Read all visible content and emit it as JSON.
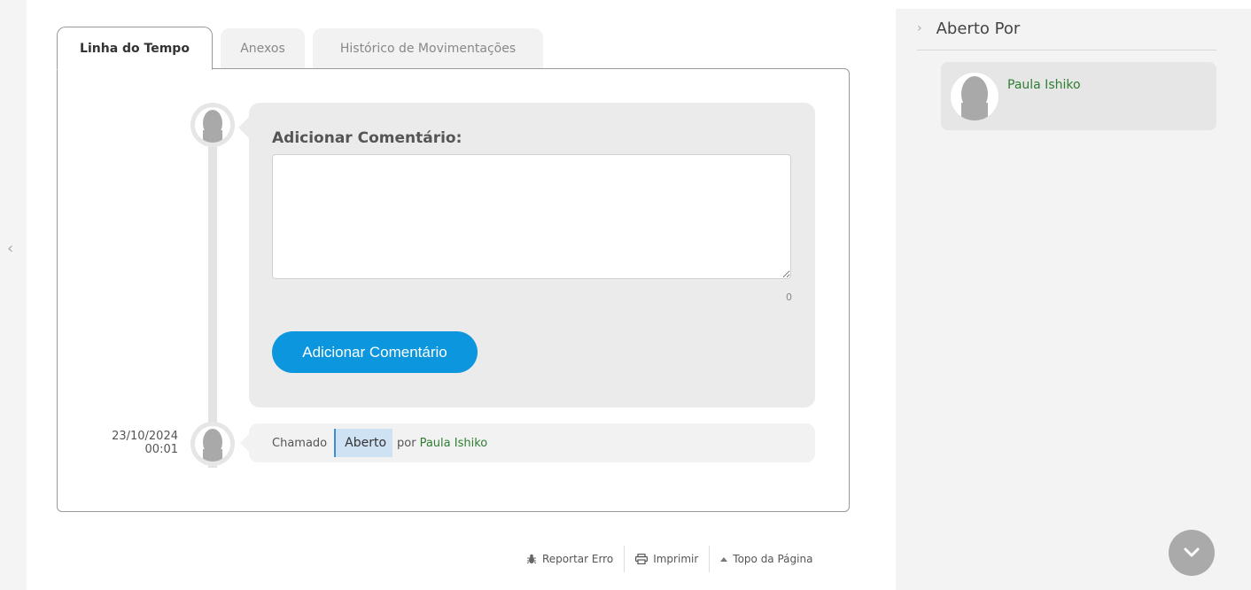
{
  "tabs": [
    {
      "label": "Linha do Tempo",
      "active": true
    },
    {
      "label": "Anexos",
      "active": false
    },
    {
      "label": "Histórico de Movimentações",
      "active": false
    }
  ],
  "comment": {
    "title": "Adicionar Comentário:",
    "textarea_value": "",
    "char_count": "0",
    "button_label": "Adicionar Comentário"
  },
  "timeline_event": {
    "date": "23/10/2024",
    "time": "00:01",
    "type": "Chamado",
    "status": "Aberto",
    "por": "por",
    "user": "Paula Ishiko"
  },
  "footer": {
    "report_error": "Reportar Erro",
    "print": "Imprimir",
    "top_of_page": "Topo da Página"
  },
  "sidebar": {
    "section_title": "Aberto Por",
    "opened_by_user": "Paula Ishiko"
  },
  "colors": {
    "accent_button": "#0b96dd",
    "user_link": "#2e7d32",
    "status_badge_bg": "#cfe2f3"
  },
  "icons": {
    "left_collapse": "chevron-left-icon",
    "sidebar_expand": "chevron-right-icon",
    "report": "bug-icon",
    "print": "printer-icon",
    "top": "caret-up-icon",
    "scroll_down": "chevron-down-icon"
  }
}
